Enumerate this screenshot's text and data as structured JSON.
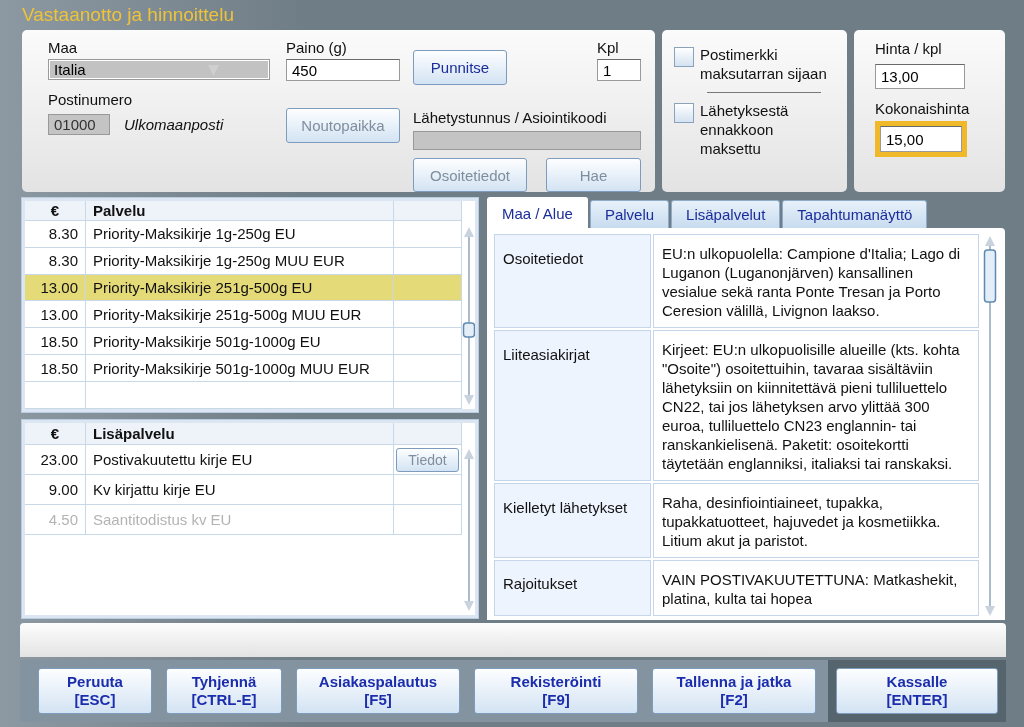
{
  "title": "Vastaanotto ja hinnoittelu",
  "form": {
    "country": {
      "label": "Maa",
      "value": "Italia"
    },
    "weight": {
      "label": "Paino (g)",
      "value": "450"
    },
    "weigh_button": {
      "label": "Punnitse",
      "disabled": false
    },
    "quantity": {
      "label": "Kpl",
      "value": "1"
    },
    "postal_code": {
      "label": "Postinumero",
      "value": "01000",
      "note": "Ulkomaanposti"
    },
    "pickup_button": {
      "label": "Noutopaikka",
      "disabled": true
    },
    "tracking": {
      "label": "Lähetystunnus / Asiointikoodi"
    },
    "address_button": {
      "label": "Osoitetiedot",
      "disabled": true
    },
    "search_button": {
      "label": "Hae",
      "disabled": true
    }
  },
  "options": [
    {
      "label": "Postimerkki maksutarran sijaan",
      "checked": false
    },
    {
      "label": "Lähetyksestä ennakkoon maksettu",
      "checked": false
    }
  ],
  "pricing": {
    "unit_price": {
      "label": "Hinta / kpl",
      "value": "13,00"
    },
    "total": {
      "label": "Kokonaishinta",
      "value": "15,00",
      "highlighted": true
    }
  },
  "services": {
    "columns": [
      "€",
      "Palvelu"
    ],
    "rows": [
      {
        "price": "8.30",
        "name": "Priority-Maksikirje 1g-250g EU",
        "selected": false
      },
      {
        "price": "8.30",
        "name": "Priority-Maksikirje 1g-250g MUU EUR",
        "selected": false
      },
      {
        "price": "13.00",
        "name": "Priority-Maksikirje 251g-500g EU",
        "selected": true
      },
      {
        "price": "13.00",
        "name": "Priority-Maksikirje 251g-500g MUU EUR",
        "selected": false
      },
      {
        "price": "18.50",
        "name": "Priority-Maksikirje 501g-1000g EU",
        "selected": false
      },
      {
        "price": "18.50",
        "name": "Priority-Maksikirje 501g-1000g MUU EUR",
        "selected": false
      }
    ]
  },
  "extras": {
    "columns": [
      "€",
      "Lisäpalvelu"
    ],
    "rows": [
      {
        "price": "23.00",
        "name": "Postivakuutettu kirje EU",
        "disabled": false,
        "button": {
          "label": "Tiedot",
          "disabled": true
        }
      },
      {
        "price": "9.00",
        "name": "Kv kirjattu kirje EU",
        "disabled": false
      },
      {
        "price": "4.50",
        "name": "Saantitodistus kv EU",
        "disabled": true
      }
    ]
  },
  "tabs": [
    {
      "label": "Maa / Alue",
      "selected": true
    },
    {
      "label": "Palvelu",
      "selected": false
    },
    {
      "label": "Lisäpalvelut",
      "selected": false
    },
    {
      "label": "Tapahtumanäyttö",
      "selected": false
    }
  ],
  "info": [
    {
      "label": "Osoitetiedot",
      "text": "EU:n ulkopuolella: Campione d'Italia; Lago di Luganon (Luganonjärven) kansallinen vesialue sekä ranta Ponte Tresan ja Porto Ceresion välillä, Livignon laakso."
    },
    {
      "label": "Liiteasiakirjat",
      "text": "Kirjeet: EU:n ulkopuolisille alueille (kts. kohta \"Osoite\") osoitettuihin, tavaraa sisältäviin lähetyksiin on kiinnitettävä pieni tulliluettelo CN22, tai jos lähetyksen arvo ylittää 300 euroa, tulliluettelo CN23 englannin- tai ranskankielisenä. Paketit: osoitekortti täytetään englanniksi, italiaksi tai ranskaksi."
    },
    {
      "label": "Kielletyt lähetykset",
      "text": "Raha, desinfiointiaineet, tupakka, tupakkatuotteet, hajuvedet ja kosmetiikka. Litium akut ja paristot."
    },
    {
      "label": "Rajoitukset",
      "text": "VAIN POSTIVAKUUTETTUNA: Matkashekit, platina, kulta tai hopea"
    }
  ],
  "buttons": [
    {
      "label": "Peruuta",
      "key": "[ESC]",
      "primary": false
    },
    {
      "label": "Tyhjennä",
      "key": "[CTRL-E]",
      "primary": false
    },
    {
      "label": "Asiakaspalautus",
      "key": "[F5]",
      "primary": false
    },
    {
      "label": "Rekisteröinti",
      "key": "[F9]",
      "primary": false
    },
    {
      "label": "Tallenna ja jatka",
      "key": "[F2]",
      "primary": false
    },
    {
      "label": "Kassalle",
      "key": "[ENTER]",
      "primary": true
    }
  ]
}
